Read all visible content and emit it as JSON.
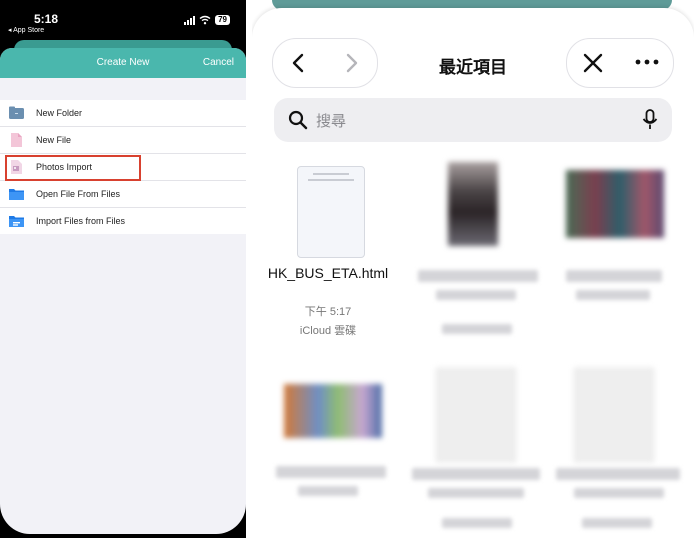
{
  "left": {
    "status": {
      "time": "5:18",
      "back_app": "◂ App Store",
      "battery": "79"
    },
    "sheet": {
      "title": "Create New",
      "cancel": "Cancel"
    },
    "menu_items": [
      {
        "label": "New Folder",
        "icon": "folder-icon"
      },
      {
        "label": "New File",
        "icon": "file-icon"
      },
      {
        "label": "Photos Import",
        "icon": "photo-import-icon"
      },
      {
        "label": "Open File From Files",
        "icon": "files-app-icon"
      },
      {
        "label": "Import Files from Files",
        "icon": "files-import-icon"
      }
    ],
    "highlighted_item": "Import Files from Files",
    "colors": {
      "header": "#4ab7ad",
      "highlight": "#d8412f"
    }
  },
  "right": {
    "title": "最近項目",
    "search_placeholder": "搜尋",
    "files": [
      {
        "name": "HK_BUS_ETA.html",
        "time": "下午 5:17",
        "location": "iCloud 雲碟"
      }
    ]
  }
}
